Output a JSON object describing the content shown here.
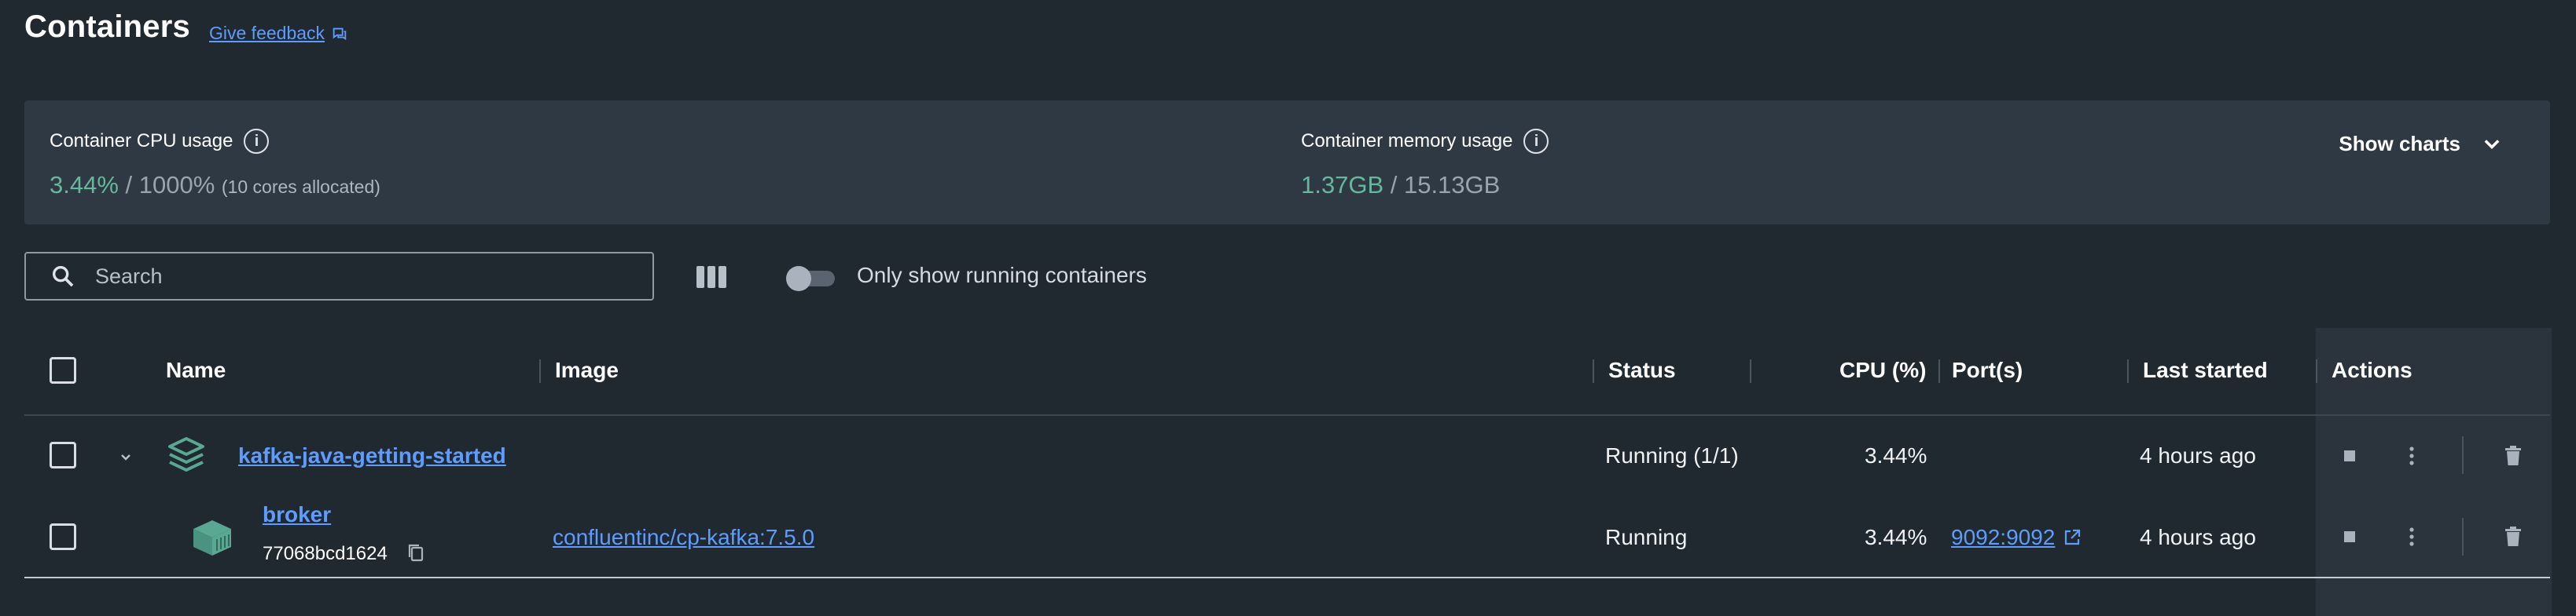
{
  "header": {
    "title": "Containers",
    "feedback_label": "Give feedback"
  },
  "usage": {
    "cpu_label": "Container CPU usage",
    "cpu_value": "3.44%",
    "cpu_total": " / 1000%",
    "cpu_note": "(10 cores allocated)",
    "memory_label": "Container memory usage",
    "memory_value": "1.37GB",
    "memory_total": " / 15.13GB",
    "show_charts_label": "Show charts"
  },
  "toolbar": {
    "search_placeholder": "Search",
    "running_toggle_label": "Only show running containers",
    "running_toggle_on": false
  },
  "table": {
    "columns": [
      "Name",
      "Image",
      "Status",
      "CPU (%)",
      "Port(s)",
      "Last started",
      "Actions"
    ],
    "group": {
      "name": "kafka-java-getting-started",
      "status": "Running (1/1)",
      "cpu": "3.44%",
      "last_started": "4 hours ago"
    },
    "container": {
      "name": "broker",
      "id": "77068bcd1624",
      "image": "confluentinc/cp-kafka:7.5.0",
      "status": "Running",
      "cpu": "3.44%",
      "ports": "9092:9092",
      "last_started": "4 hours ago"
    }
  },
  "colors": {
    "background": "#202830",
    "panel": "#2f3943",
    "accent_link": "#5e9dff",
    "usage_green": "#64b89b",
    "container_icon": "#5aa892"
  },
  "icons": [
    "feedback-icon",
    "info-icon",
    "chevron-down-icon",
    "search-icon",
    "columns-icon",
    "stack-icon",
    "container-icon",
    "copy-icon",
    "external-link-icon",
    "stop-icon",
    "more-icon",
    "trash-icon"
  ]
}
